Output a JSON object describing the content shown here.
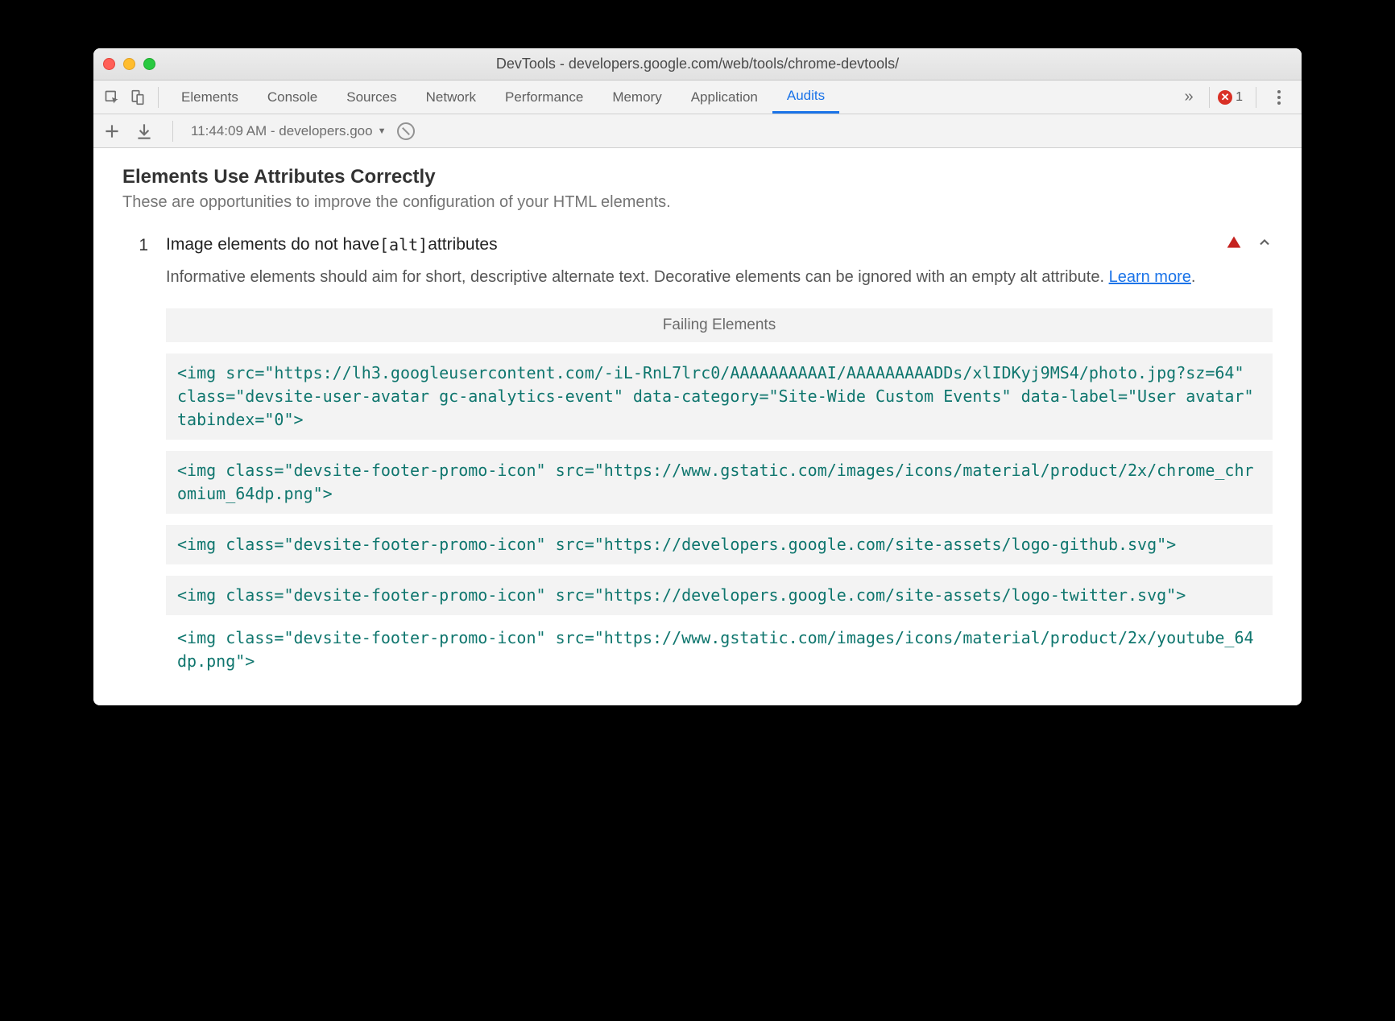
{
  "window": {
    "title": "DevTools - developers.google.com/web/tools/chrome-devtools/"
  },
  "tabs": {
    "items": [
      "Elements",
      "Console",
      "Sources",
      "Network",
      "Performance",
      "Memory",
      "Application",
      "Audits"
    ],
    "active": "Audits",
    "errors": "1"
  },
  "subbar": {
    "run_label": "11:44:09 AM - developers.goo"
  },
  "section": {
    "title": "Elements Use Attributes Correctly",
    "subtitle": "These are opportunities to improve the configuration of your HTML elements."
  },
  "audit": {
    "count": "1",
    "title_pre": "Image elements do not have ",
    "title_code": "[alt]",
    "title_post": " attributes",
    "desc_pre": "Informative elements should aim for short, descriptive alternate text. Decorative elements can be ignored with an empty alt attribute. ",
    "learn_more": "Learn more",
    "desc_post": ".",
    "failing_header": "Failing Elements",
    "elements": [
      "<img src=\"https://lh3.googleusercontent.com/-iL-RnL7lrc0/AAAAAAAAAAI/AAAAAAAAADDs/xlIDKyj9MS4/photo.jpg?sz=64\" class=\"devsite-user-avatar gc-analytics-event\" data-category=\"Site-Wide Custom Events\" data-label=\"User avatar\" tabindex=\"0\">",
      "<img class=\"devsite-footer-promo-icon\" src=\"https://www.gstatic.com/images/icons/material/product/2x/chrome_chromium_64dp.png\">",
      "<img class=\"devsite-footer-promo-icon\" src=\"https://developers.google.com/site-assets/logo-github.svg\">",
      "<img class=\"devsite-footer-promo-icon\" src=\"https://developers.google.com/site-assets/logo-twitter.svg\">",
      "<img class=\"devsite-footer-promo-icon\" src=\"https://www.gstatic.com/images/icons/material/product/2x/youtube_64dp.png\">"
    ]
  }
}
